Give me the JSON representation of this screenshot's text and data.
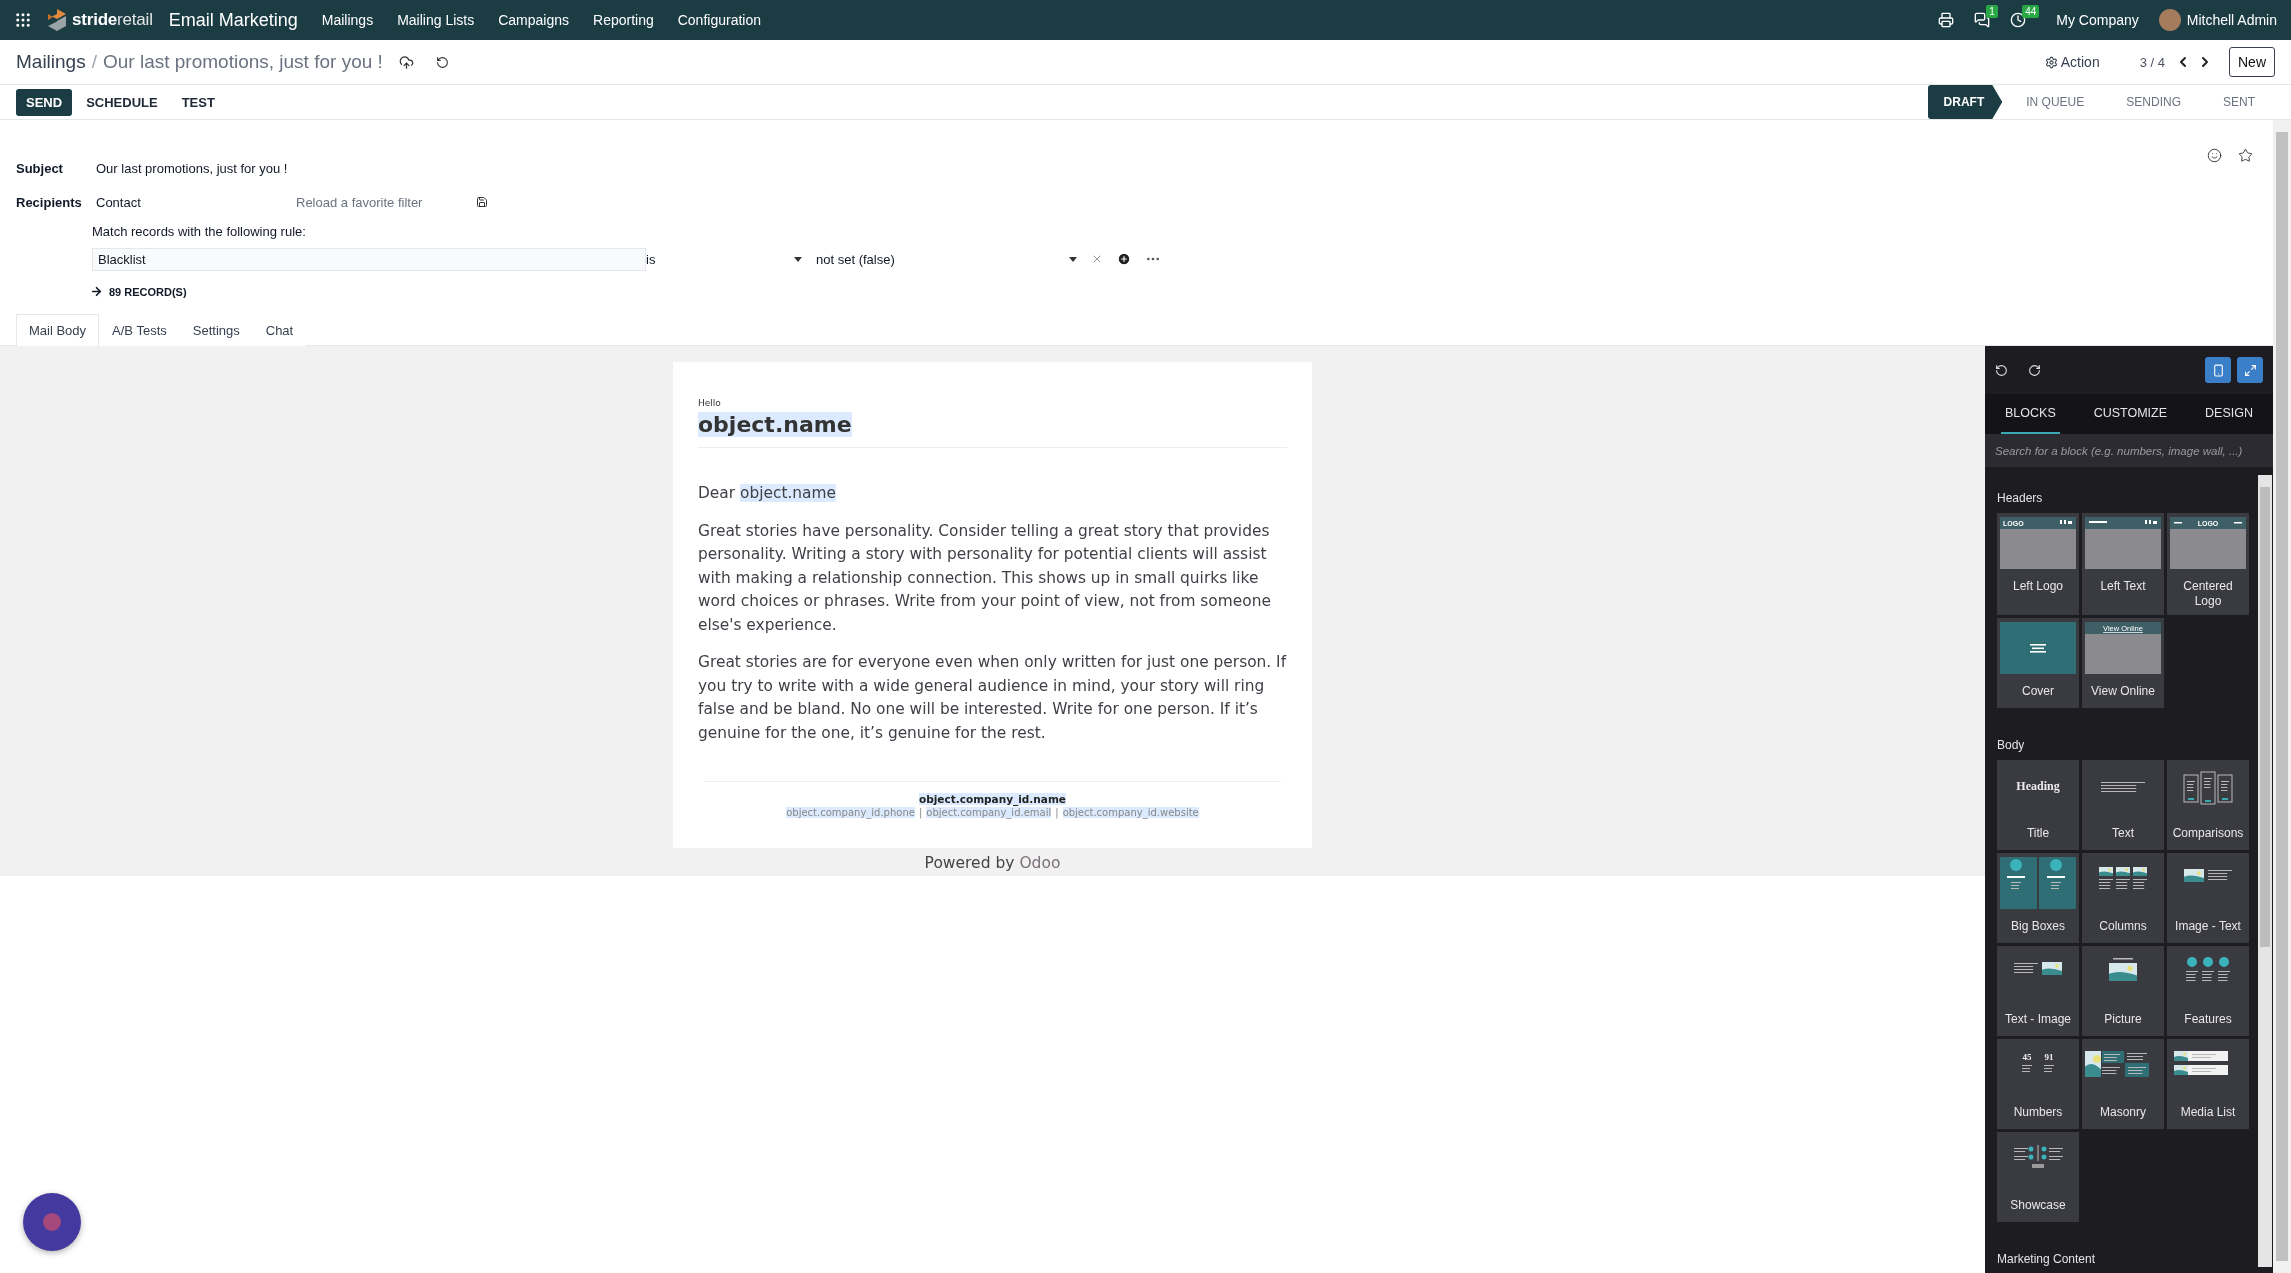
{
  "navbar": {
    "brand": "**stride**retail",
    "app": "Email Marketing",
    "menus": [
      "Mailings",
      "Mailing Lists",
      "Campaigns",
      "Reporting",
      "Configuration"
    ],
    "messages_badge": "1",
    "activities_badge": "44",
    "company": "My Company",
    "user": "Mitchell Admin"
  },
  "breadcrumb": {
    "parent": "Mailings",
    "separator": "/",
    "current": "Our last promotions, just for you !"
  },
  "pager": {
    "action": "Action",
    "counter": "3 / 4",
    "new_button": "New"
  },
  "buttons": [
    {
      "label": "SEND",
      "primary": true
    },
    {
      "label": "SCHEDULE",
      "primary": false
    },
    {
      "label": "TEST",
      "primary": false
    }
  ],
  "stages": [
    {
      "label": "DRAFT",
      "selected": true
    },
    {
      "label": "IN QUEUE",
      "selected": false
    },
    {
      "label": "SENDING",
      "selected": false
    },
    {
      "label": "SENT",
      "selected": false
    }
  ],
  "form": {
    "subject_label": "Subject",
    "subject": "Our last promotions, just for you !",
    "recipients_label": "Recipients",
    "recipients_model": "Contact",
    "filter_placeholder": "Reload a favorite filter",
    "rule_caption": "Match records with the following rule:",
    "rule": {
      "field": "Blacklist",
      "operator": "is",
      "value": "not set (false)"
    },
    "records": "89 RECORD(S)"
  },
  "tabs": [
    {
      "label": "Mail Body",
      "selected": true
    },
    {
      "label": "A/B Tests",
      "selected": false
    },
    {
      "label": "Settings",
      "selected": false
    },
    {
      "label": "Chat",
      "selected": false
    }
  ],
  "email": {
    "hello": "Hello",
    "heading": "object.name",
    "greeting": "Dear",
    "greeting_field": "object.name",
    "paragraphs": [
      "Great stories have personality. Consider telling a great story that provides personality. Writing a story with personality for potential clients will assist with making a relationship connection. This shows up in small quirks like word choices or phrases. Write from your point of view, not from someone else's experience.",
      "Great stories are for everyone even when only written for just one person. If you try to write with a wide general audience in mind, your story will ring false and be bland. No one will be interested. Write for one person. If it’s genuine for the one, it’s genuine for the rest."
    ],
    "company": "object.company_id.name",
    "contacts": [
      "object.company_id.phone",
      "object.company_id.email",
      "object.company_id.website"
    ],
    "separator": "|"
  },
  "powered": {
    "text": "Powered by",
    "brand": "Odoo"
  },
  "builder": {
    "tabs": [
      {
        "label": "BLOCKS",
        "selected": true
      },
      {
        "label": "CUSTOMIZE",
        "selected": false
      },
      {
        "label": "DESIGN",
        "selected": false
      }
    ],
    "search_placeholder": "Search for a block (e.g. numbers, image wall, ...)",
    "sections": [
      {
        "title": "Headers",
        "blocks": [
          {
            "label": "Left Logo",
            "kind": "leftlogo",
            "thumb_texts": [
              "LOGO"
            ]
          },
          {
            "label": "Left Text",
            "kind": "lefttext"
          },
          {
            "label": "Centered Logo",
            "kind": "centeredlogo",
            "thumb_texts": [
              "LOGO"
            ]
          },
          {
            "label": "Cover",
            "kind": "cover"
          },
          {
            "label": "View Online",
            "kind": "viewonline",
            "thumb_texts": [
              "View Online"
            ]
          }
        ]
      },
      {
        "title": "Body",
        "blocks": [
          {
            "label": "Title",
            "kind": "title",
            "thumb_texts": [
              "Heading"
            ]
          },
          {
            "label": "Text",
            "kind": "text"
          },
          {
            "label": "Comparisons",
            "kind": "comparisons"
          },
          {
            "label": "Big Boxes",
            "kind": "bigboxes"
          },
          {
            "label": "Columns",
            "kind": "columns"
          },
          {
            "label": "Image - Text",
            "kind": "imagetext"
          },
          {
            "label": "Text - Image",
            "kind": "textimage"
          },
          {
            "label": "Picture",
            "kind": "picture"
          },
          {
            "label": "Features",
            "kind": "features"
          },
          {
            "label": "Numbers",
            "kind": "numbers",
            "thumb_texts": [
              "45",
              "91"
            ]
          },
          {
            "label": "Masonry",
            "kind": "masonry"
          },
          {
            "label": "Media List",
            "kind": "medialist"
          },
          {
            "label": "Showcase",
            "kind": "showcase"
          }
        ]
      },
      {
        "title": "Marketing Content"
      }
    ]
  }
}
